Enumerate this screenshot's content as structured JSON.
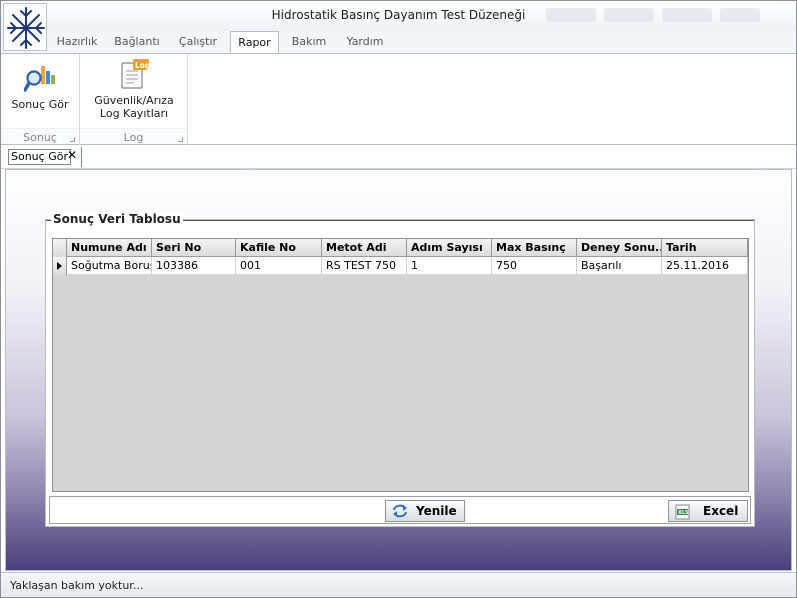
{
  "window": {
    "title": "Hidrostatik Basınç Dayanım Test Düzeneği"
  },
  "ribbon": {
    "tabs": [
      {
        "label": "Hazırlık"
      },
      {
        "label": "Bağlantı"
      },
      {
        "label": "Çalıştır"
      },
      {
        "label": "Rapor"
      },
      {
        "label": "Bakım"
      },
      {
        "label": "Yardım"
      }
    ],
    "active_tab": "Rapor",
    "groups": [
      {
        "label": "Sonuç",
        "button": "Sonuç Gör"
      },
      {
        "label": "Log",
        "button_line1": "Güvenlik/Arıza",
        "button_line2": "Log Kayıtları",
        "badge": "Log"
      }
    ]
  },
  "document_tab": {
    "label": "Sonuç Gör",
    "close": "✕"
  },
  "results": {
    "title": "Sonuç Veri Tablosu",
    "columns": [
      "Numune Adı",
      "Seri No",
      "Kafile No",
      "Metot Adi",
      "Adım Sayısı",
      "Max Basınç",
      "Deney Sonu...",
      "Tarih"
    ],
    "rows": [
      [
        "Soğutma Borusu",
        "103386",
        "001",
        "RS TEST 750",
        "1",
        "750",
        "Başarılı",
        "25.11.2016"
      ]
    ],
    "refresh_label": "Yenile",
    "excel_label": "Excel"
  },
  "status": {
    "text": "Yaklaşan bakım yoktur..."
  },
  "colors": {
    "accent": "#3a66b0",
    "content_bottom": "#4b3f7a"
  }
}
